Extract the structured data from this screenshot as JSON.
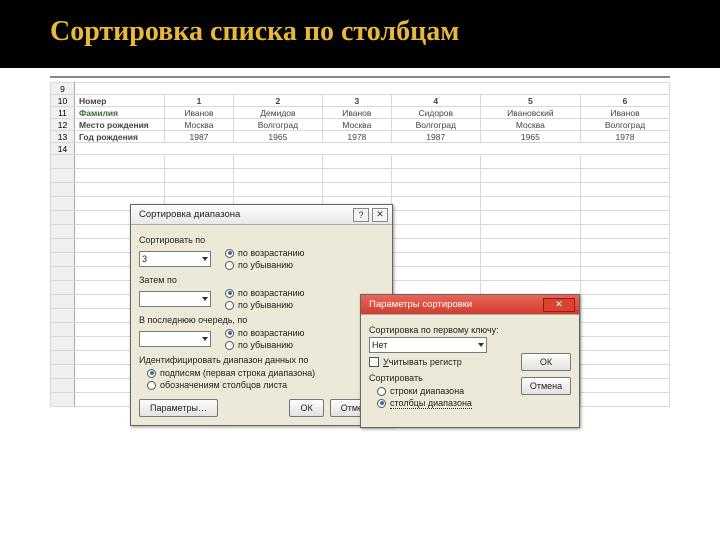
{
  "slide_title": "Сортировка списка по столбцам",
  "rows": [
    "9",
    "10",
    "11",
    "12",
    "13",
    "14"
  ],
  "table": {
    "r10": {
      "label": "Номер",
      "c": [
        "1",
        "2",
        "3",
        "4",
        "5",
        "6"
      ]
    },
    "r11": {
      "label": "Фамилия",
      "c": [
        "Иванов",
        "Демидов",
        "Иванов",
        "Сидоров",
        "Ивановский",
        "Иванов"
      ]
    },
    "r12": {
      "label": "Место рождения",
      "c": [
        "Москва",
        "Волгоград",
        "Москва",
        "Волгоград",
        "Москва",
        "Волгоград"
      ]
    },
    "r13": {
      "label": "Год рождения",
      "c": [
        "1987",
        "1965",
        "1978",
        "1987",
        "1965",
        "1978"
      ]
    }
  },
  "d1": {
    "title": "Сортировка диапазона",
    "sort_by": "Сортировать по",
    "then": "Затем по",
    "last": "В последнюю очередь, по",
    "sel1": "3",
    "sel2": "",
    "sel3": "",
    "asc": "по возрастанию",
    "desc": "по убыванию",
    "ident": "Идентифицировать диапазон данных по",
    "id_labels": "подписям (первая строка диапазона)",
    "id_cols": "обозначениям столбцов листа",
    "params": "Параметры…",
    "ok": "ОК",
    "cancel": "Отмена"
  },
  "d2": {
    "title": "Параметры сортировки",
    "first_key": "Сортировка по первому ключу:",
    "first_val": "Нет",
    "case": "Учитывать регистр",
    "sortlbl": "Сортировать",
    "rows": "строки диапазона",
    "cols": "столбцы диапазона",
    "ok": "ОК",
    "cancel": "Отмена"
  }
}
